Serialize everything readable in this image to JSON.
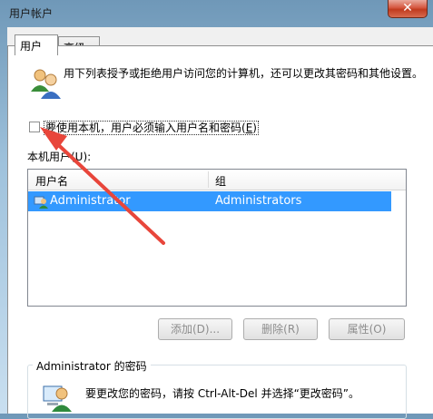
{
  "window": {
    "title": "用户帐户",
    "close_glyph": "✕"
  },
  "tabs": [
    {
      "label": "用户"
    },
    {
      "label": "高级"
    }
  ],
  "description": "用下列表授予或拒绝用户访问您的计算机，还可以更改其密码和其他设置。",
  "checkbox": {
    "label_prefix": "要使用本机，用户必须输入用户名和密码(",
    "mnemonic": "E",
    "label_suffix": ")",
    "checked": false
  },
  "users_section": {
    "label": "本机用户(U):"
  },
  "users_table": {
    "columns": [
      "用户名",
      "组"
    ],
    "rows": [
      {
        "name": "Administrator",
        "group": "Administrators",
        "selected": true
      }
    ]
  },
  "buttons": {
    "add": "添加(D)...",
    "remove": "删除(R)",
    "properties": "属性(O)"
  },
  "password_group": {
    "title": "Administrator 的密码",
    "text": "要更改您的密码，请按 Ctrl-Alt-Del 并选择“更改密码”。"
  },
  "colors": {
    "selection": "#3399ff",
    "annotation_arrow": "#e8463b"
  }
}
